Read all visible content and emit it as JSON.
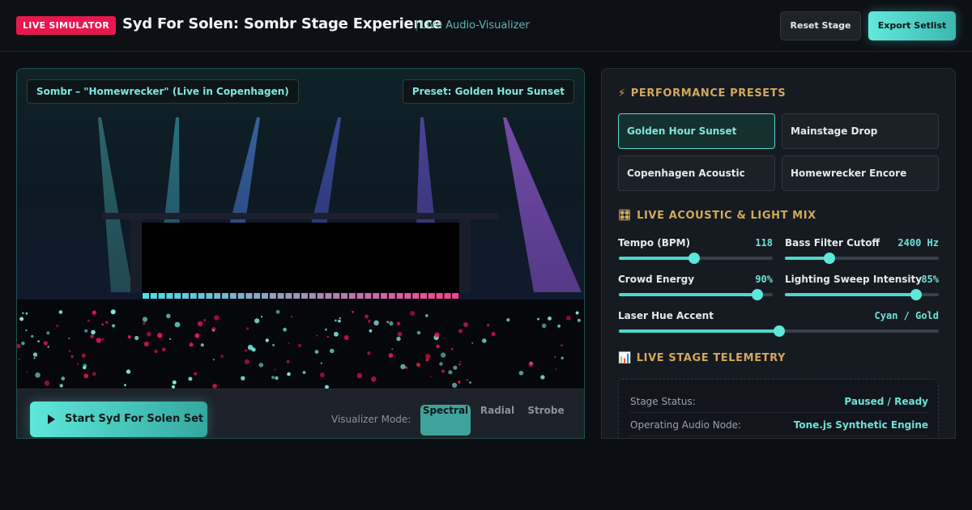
{
  "header": {
    "badge": "LIVE SIMULATOR",
    "title": "Syd For Solen: Sombr Stage Experience",
    "subtitle": "Live Audio-Visualizer",
    "reset_label": "Reset Stage",
    "export_label": "Export Setlist"
  },
  "stage": {
    "track": "Sombr – \"Homewrecker\" (Live in Copenhagen)",
    "preset_chip": "Preset: Golden Hour Sunset",
    "start_label": "Start Syd For Solen Set",
    "mode_label": "Visualizer Mode:",
    "modes": [
      "Spectral",
      "Radial",
      "Strobe"
    ],
    "active_mode": "Spectral"
  },
  "presets": {
    "heading": "PERFORMANCE PRESETS",
    "icon": "lightning-icon",
    "items": [
      "Golden Hour Sunset",
      "Mainstage Drop",
      "Copenhagen Acoustic",
      "Homewrecker Encore"
    ],
    "active": "Golden Hour Sunset"
  },
  "mix": {
    "heading": "LIVE ACOUSTIC & LIGHT MIX",
    "icon": "control-knobs-icon",
    "sliders": [
      {
        "label": "Tempo (BPM)",
        "value": "118",
        "level": 0.49
      },
      {
        "label": "Bass Filter Cutoff",
        "value": "2400 Hz",
        "level": 0.29
      },
      {
        "label": "Crowd Energy",
        "value": "90%",
        "level": 0.9
      },
      {
        "label": "Lighting Sweep Intensity",
        "value": "85%",
        "level": 0.85
      },
      {
        "label": "Laser Hue Accent",
        "value": "Cyan / Gold",
        "level": 0.5
      }
    ]
  },
  "telemetry": {
    "heading": "LIVE STAGE TELEMETRY",
    "icon": "bar-chart-icon",
    "rows": [
      {
        "key": "Stage Status:",
        "value": "Paused / Ready"
      },
      {
        "key": "Operating Audio Node:",
        "value": "Tone.js Synthetic Engine"
      }
    ]
  },
  "colors": {
    "accent": "#5ee8da",
    "gold": "#d4a85a",
    "live_badge": "#e8184d",
    "crowd_red": "#e0174a"
  }
}
